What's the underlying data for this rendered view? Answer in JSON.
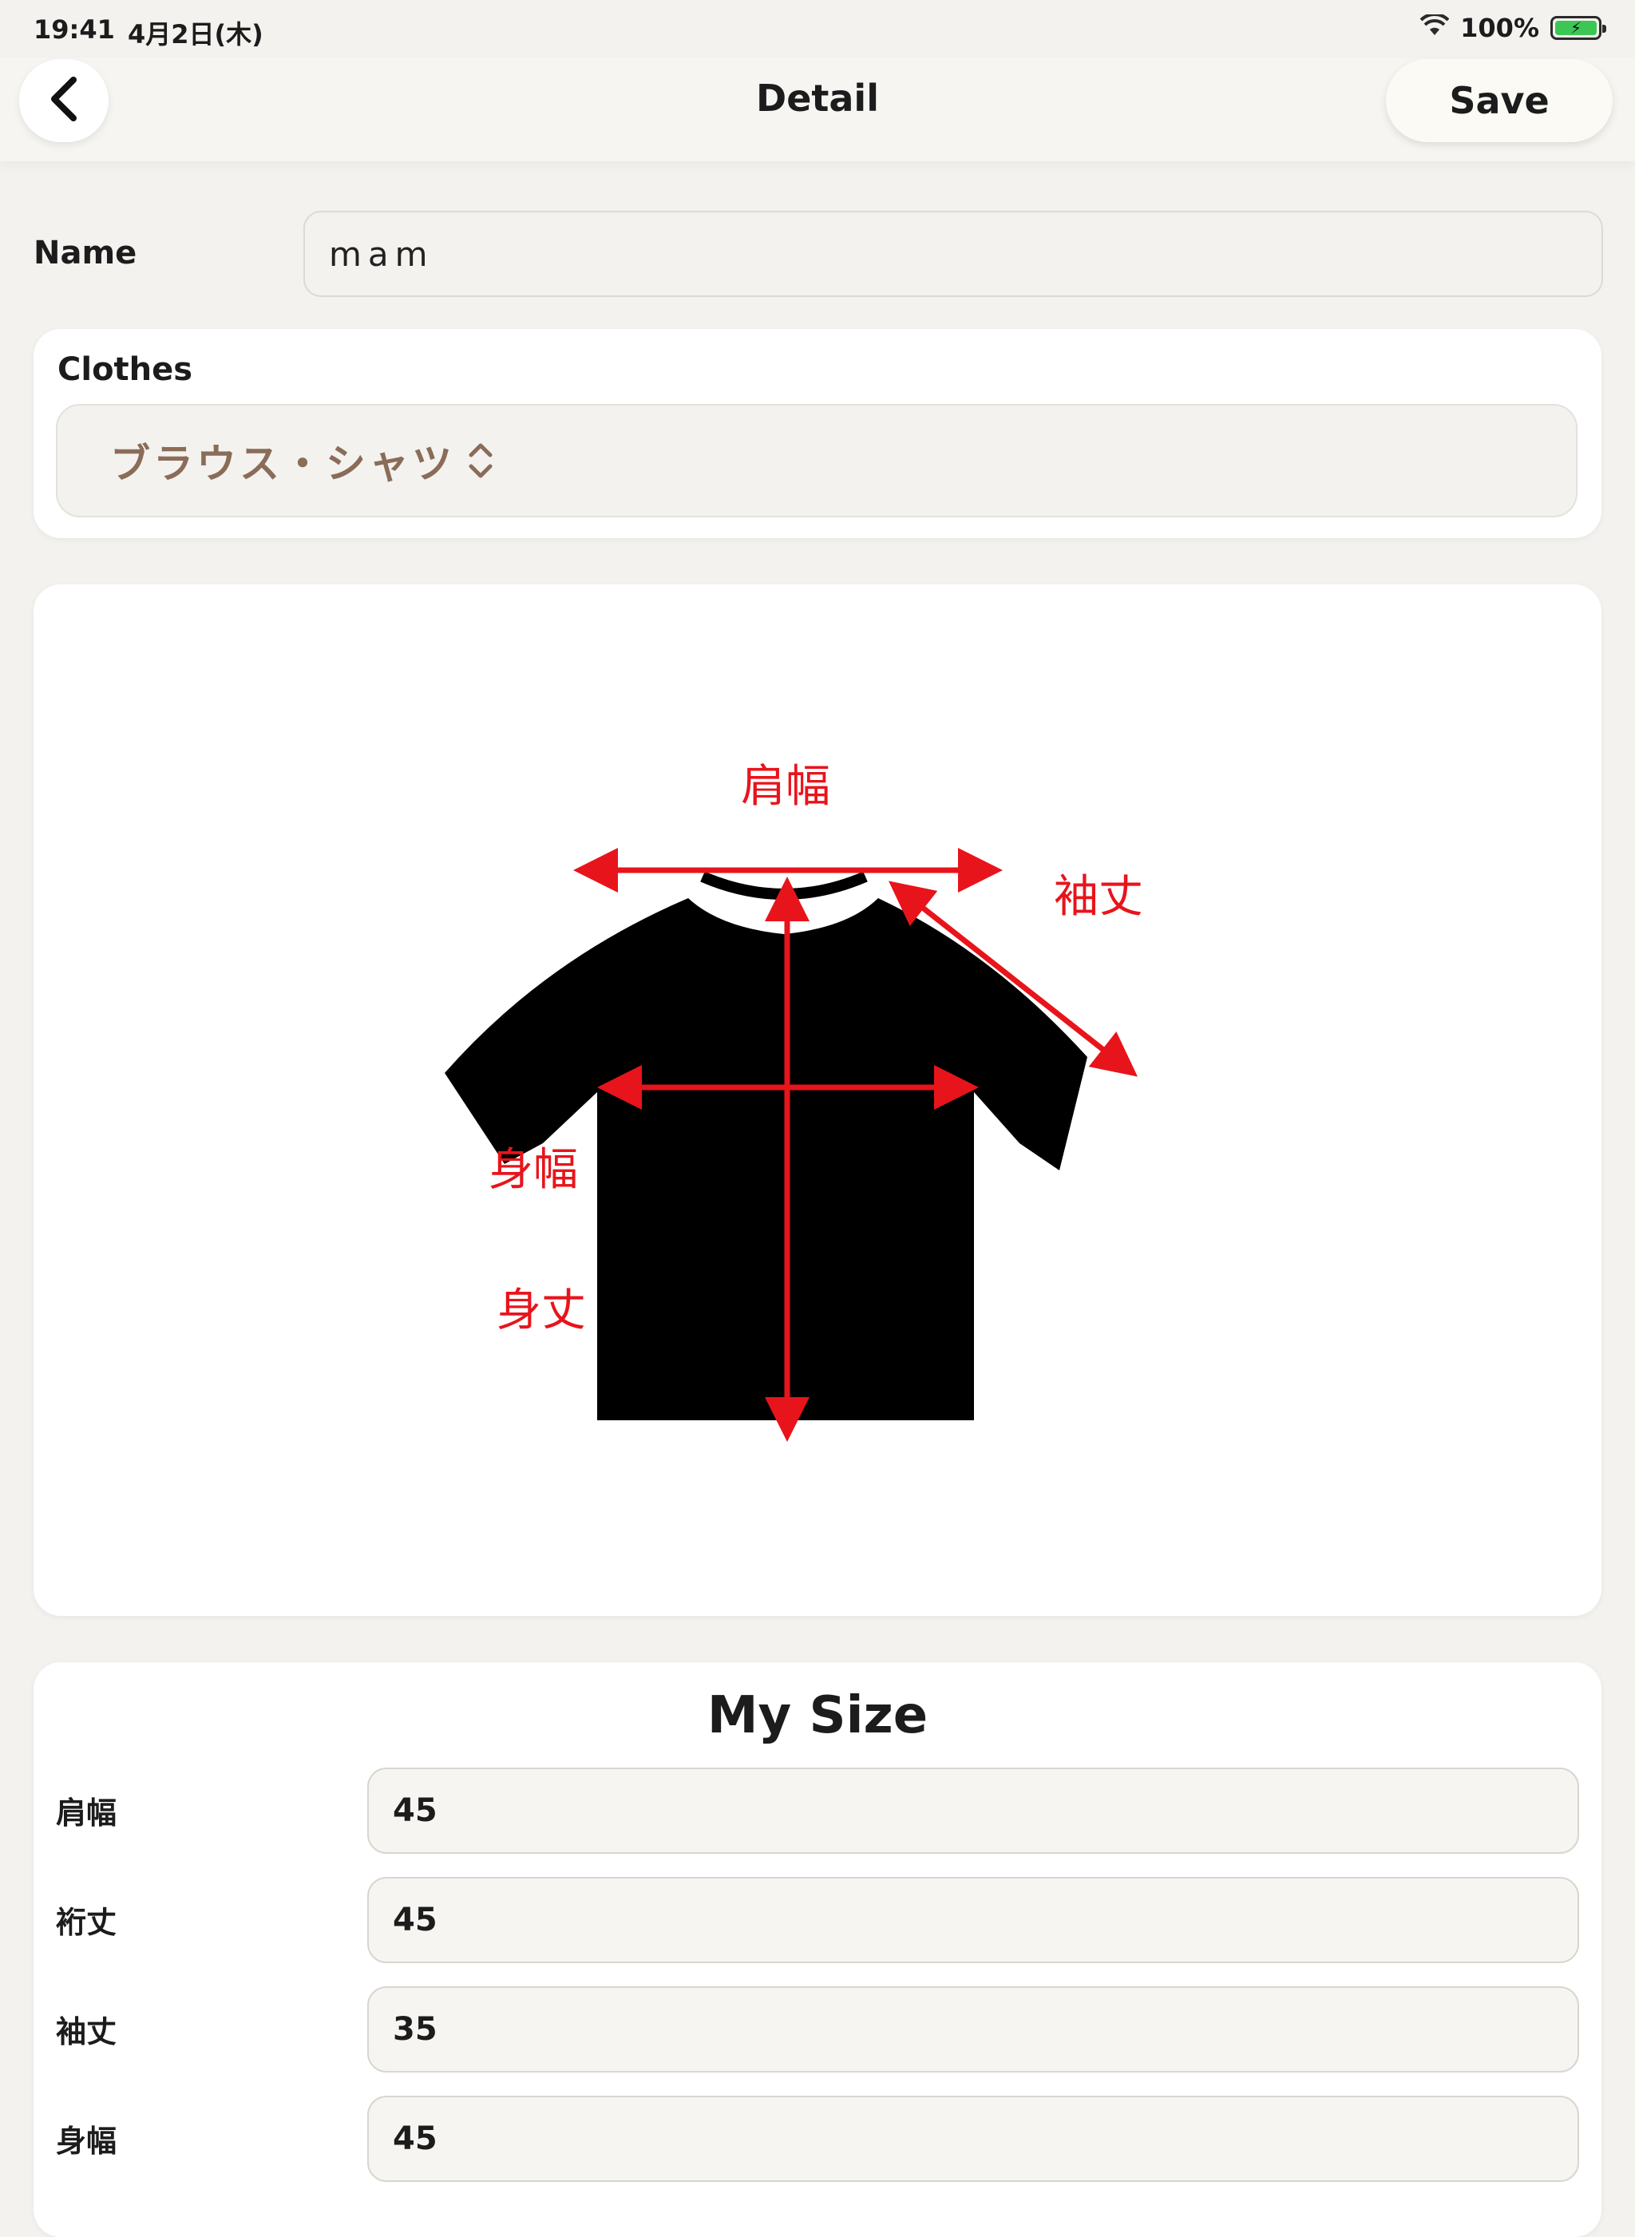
{
  "status_bar": {
    "time": "19:41",
    "date": "4月2日(木)",
    "battery": "100%"
  },
  "nav": {
    "title": "Detail",
    "save_label": "Save",
    "back_icon": "chevron-left-icon"
  },
  "name": {
    "label": "Name",
    "value": "mam"
  },
  "clothes": {
    "label": "Clothes",
    "selected": "ブラウス・シャツ"
  },
  "diagram": {
    "labels": {
      "shoulder_width": "肩幅",
      "sleeve_length": "袖丈",
      "body_width": "身幅",
      "body_length": "身丈"
    },
    "arrow_color": "#e8141b",
    "shirt_color": "#000000"
  },
  "my_size": {
    "title": "My Size",
    "rows": [
      {
        "label": "肩幅",
        "value": "45"
      },
      {
        "label": "裄丈",
        "value": "45"
      },
      {
        "label": "袖丈",
        "value": "35"
      },
      {
        "label": "身幅",
        "value": "45"
      }
    ]
  }
}
